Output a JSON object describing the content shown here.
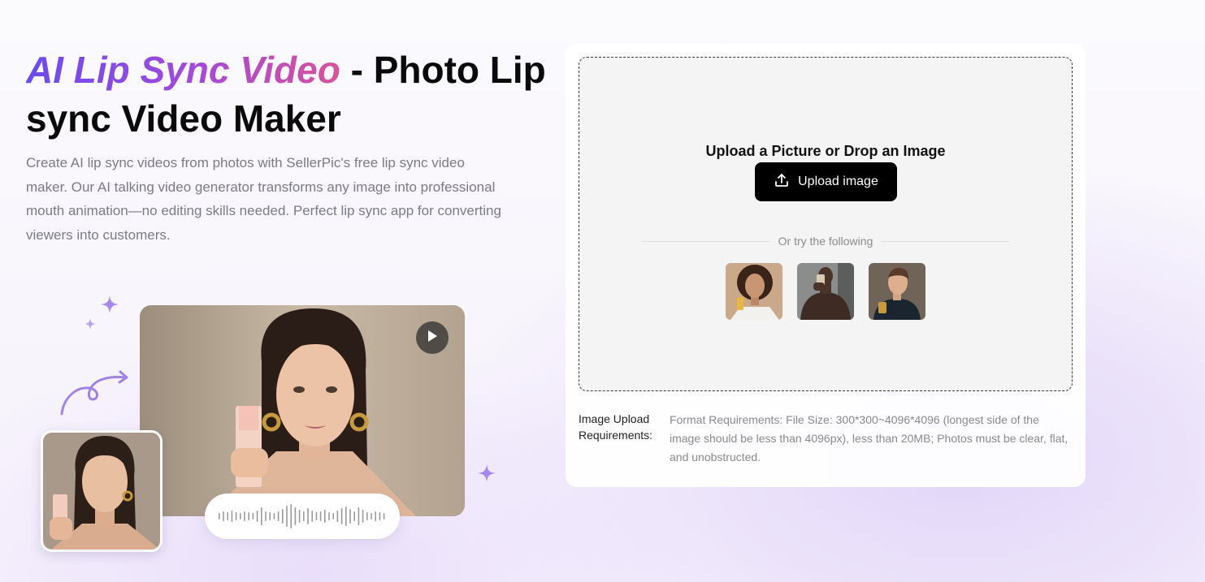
{
  "hero": {
    "title_accent": "AI Lip Sync Video",
    "title_rest": " - Photo Lip sync Video Maker",
    "description": "Create AI lip sync videos from photos with SellerPic's free lip sync video maker. Our AI talking video generator transforms any image into professional mouth animation—no editing skills needed. Perfect lip sync app for converting viewers into customers."
  },
  "upload": {
    "drop_title": "Upload a Picture or Drop an Image",
    "button_label": "Upload image",
    "divider_text": "Or try the following",
    "requirements_label": "Image Upload Requirements:",
    "requirements_text": "Format Requirements: File Size: 300*300~4096*4096 (longest side of the image should be less than 4096px), less than 20MB; Photos must be clear, flat, and unobstructed."
  },
  "samples": [
    {
      "name": "sample-woman-curly-hair"
    },
    {
      "name": "sample-man-bodybuilder"
    },
    {
      "name": "sample-man-dark-shirt"
    }
  ],
  "colors": {
    "accent_start": "#6a4cf0",
    "accent_mid": "#a54ad8",
    "accent_end": "#d8539a",
    "button_bg": "#000000",
    "sparkle": "#a689ec"
  },
  "icons": [
    "upload-icon",
    "play-icon",
    "sparkle-icon",
    "curved-arrow-icon",
    "audio-waveform-icon"
  ]
}
